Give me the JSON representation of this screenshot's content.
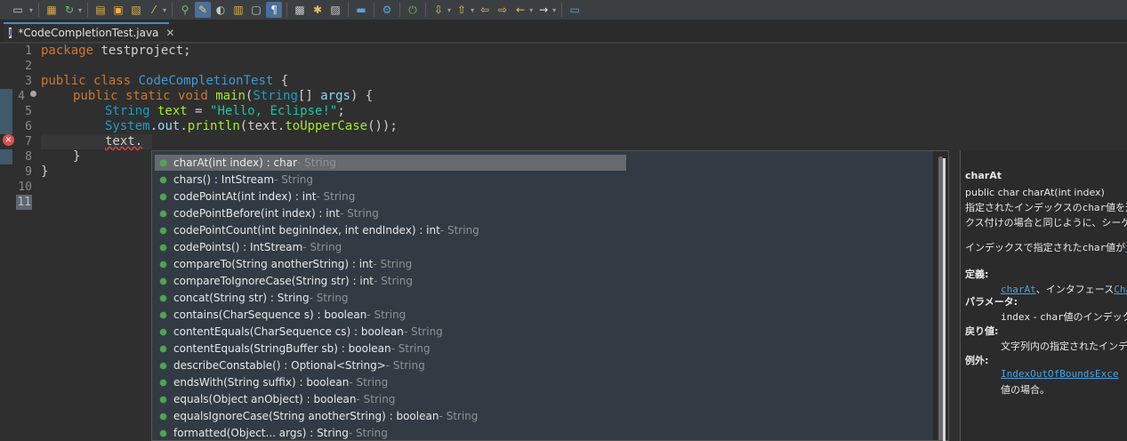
{
  "toolbar": {
    "icons": [
      "new-icon",
      "run-icon",
      "debug-icon",
      "new-project-icon",
      "open-folder-icon",
      "open-type-icon",
      "wand-icon",
      "search-icon",
      "highlight-icon",
      "toggle-mark-icon",
      "block-selection-icon",
      "show-whitespace-icon",
      "build-icon",
      "build-all-icon",
      "external-tools-icon",
      "console-icon",
      "settings-icon",
      "power-icon",
      "next-annotation-icon",
      "prev-annotation-icon",
      "last-edit-icon",
      "back-icon",
      "forward-icon",
      "open-perspective-icon"
    ]
  },
  "tab": {
    "title": "*CodeCompletionTest.java",
    "close": "✕"
  },
  "editor": {
    "line_numbers": [
      "1",
      "2",
      "3",
      "4",
      "5",
      "6",
      "7",
      "8",
      "9",
      "10",
      "11"
    ],
    "lines": {
      "l1": {
        "kw": "package",
        "rest": " testproject;"
      },
      "l3": {
        "kw1": "public",
        "kw2": "class",
        "cls": "CodeCompletionTest",
        "rest": " {"
      },
      "l4": {
        "kw1": "public",
        "kw2": "static",
        "kw3": "void",
        "method": "main",
        "p1": "(",
        "type": "String",
        "p2": "[] ",
        "param": "args",
        "p3": ") {"
      },
      "l5": {
        "type": "String",
        "var": " text",
        "eq": " = ",
        "str": "\"Hello, Eclipse!\"",
        "end": ";"
      },
      "l6": {
        "type": "System",
        "dot1": ".",
        "field": "out",
        "dot2": ".",
        "method": "println",
        "p1": "(text.",
        "method2": "toUpperCase",
        "p2": "());"
      },
      "l7": {
        "text": "text."
      },
      "l8": {
        "text": "}"
      },
      "l9": {
        "text": "}"
      }
    },
    "error_marker": "✕"
  },
  "completion": {
    "proposals": [
      {
        "sig": "charAt(int index) : char",
        "owner": " - String"
      },
      {
        "sig": "chars() : IntStream",
        "owner": " - String"
      },
      {
        "sig": "codePointAt(int index) : int",
        "owner": " - String"
      },
      {
        "sig": "codePointBefore(int index) : int",
        "owner": " - String"
      },
      {
        "sig": "codePointCount(int beginIndex, int endIndex) : int",
        "owner": " - String"
      },
      {
        "sig": "codePoints() : IntStream",
        "owner": " - String"
      },
      {
        "sig": "compareTo(String anotherString) : int",
        "owner": " - String"
      },
      {
        "sig": "compareToIgnoreCase(String str) : int",
        "owner": " - String"
      },
      {
        "sig": "concat(String str) : String",
        "owner": " - String"
      },
      {
        "sig": "contains(CharSequence s) : boolean",
        "owner": " - String"
      },
      {
        "sig": "contentEquals(CharSequence cs) : boolean",
        "owner": " - String"
      },
      {
        "sig": "contentEquals(StringBuffer sb) : boolean",
        "owner": " - String"
      },
      {
        "sig": "describeConstable() : Optional<String>",
        "owner": " - String"
      },
      {
        "sig": "endsWith(String suffix) : boolean",
        "owner": " - String"
      },
      {
        "sig": "equals(Object anObject) : boolean",
        "owner": " - String"
      },
      {
        "sig": "equalsIgnoreCase(String anotherString) : boolean",
        "owner": " - String"
      },
      {
        "sig": "formatted(Object... args) : String",
        "owner": " - String"
      }
    ]
  },
  "javadoc": {
    "title": "charAt",
    "signature": "public char charAt(int index)",
    "desc1a": "指定されたインデックスの",
    "desc1b": "char",
    "desc1c": "値を返し",
    "desc2": "クス付けの場合と同じように、シーケンス(",
    "desc3a": "インデックスで指定された",
    "desc3b": "char",
    "desc3c": "値が",
    "desc3d": "サロ",
    "def_label": "定義:",
    "def_link": "charAt",
    "def_text": "、インタフェース",
    "def_link2": "CharS",
    "param_label": "パラメータ:",
    "param_code": "index",
    "param_text1": " - ",
    "param_code2": "char",
    "param_text2": "値のインデック",
    "return_label": "戻り値:",
    "return_text": "文字列内の指定されたインデッ",
    "throws_label": "例外:",
    "throws_link": "IndexOutOfBoundsExce",
    "throws_text": "値の場合。"
  }
}
